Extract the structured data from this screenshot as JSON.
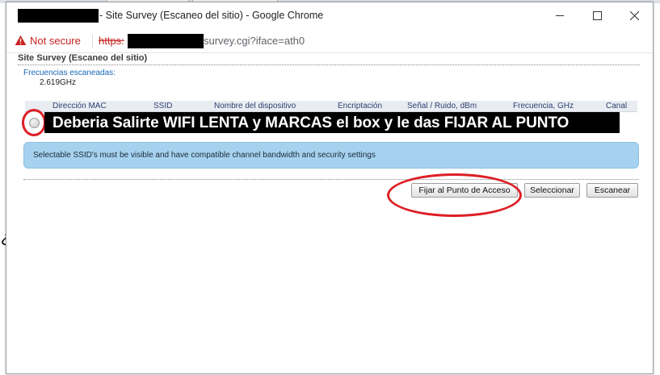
{
  "window": {
    "title": "- Site Survey (Escaneo del sitio) - Google Chrome",
    "controls": {
      "minimize_icon": "minimize-icon",
      "maximize_icon": "maximize-icon",
      "close_icon": "close-icon"
    }
  },
  "address_bar": {
    "security_text": "Not secure",
    "url_scheme": "https:",
    "url_tail": "survey.cgi?iface=ath0"
  },
  "page": {
    "title": "Site Survey (Escaneo del sitio)",
    "freq_label": "Frecuencias escaneadas:",
    "freq_value": "2.619GHz",
    "columns": [
      "Dirección MAC",
      "SSID",
      "Nombre del dispositivo",
      "Encriptación",
      "Señal / Ruido, dBm",
      "Frecuencia, GHz",
      "Canal"
    ],
    "overlay_text": "Deberia Salirte WIFI  LENTA y MARCAS el box y le das FIJAR AL PUNTO",
    "info_message": "Selectable SSID's must be visible and have compatible channel bandwidth and security settings",
    "buttons": {
      "fix": "Fijar al Punto de Acceso",
      "select": "Seleccionar",
      "scan": "Escanear"
    }
  },
  "colors": {
    "not_secure": "#c5221f",
    "link_blue": "#1a67b5",
    "info_bg": "#a6d2ef",
    "annotation_red": "#dd1f26"
  },
  "background_glyph": "¿"
}
